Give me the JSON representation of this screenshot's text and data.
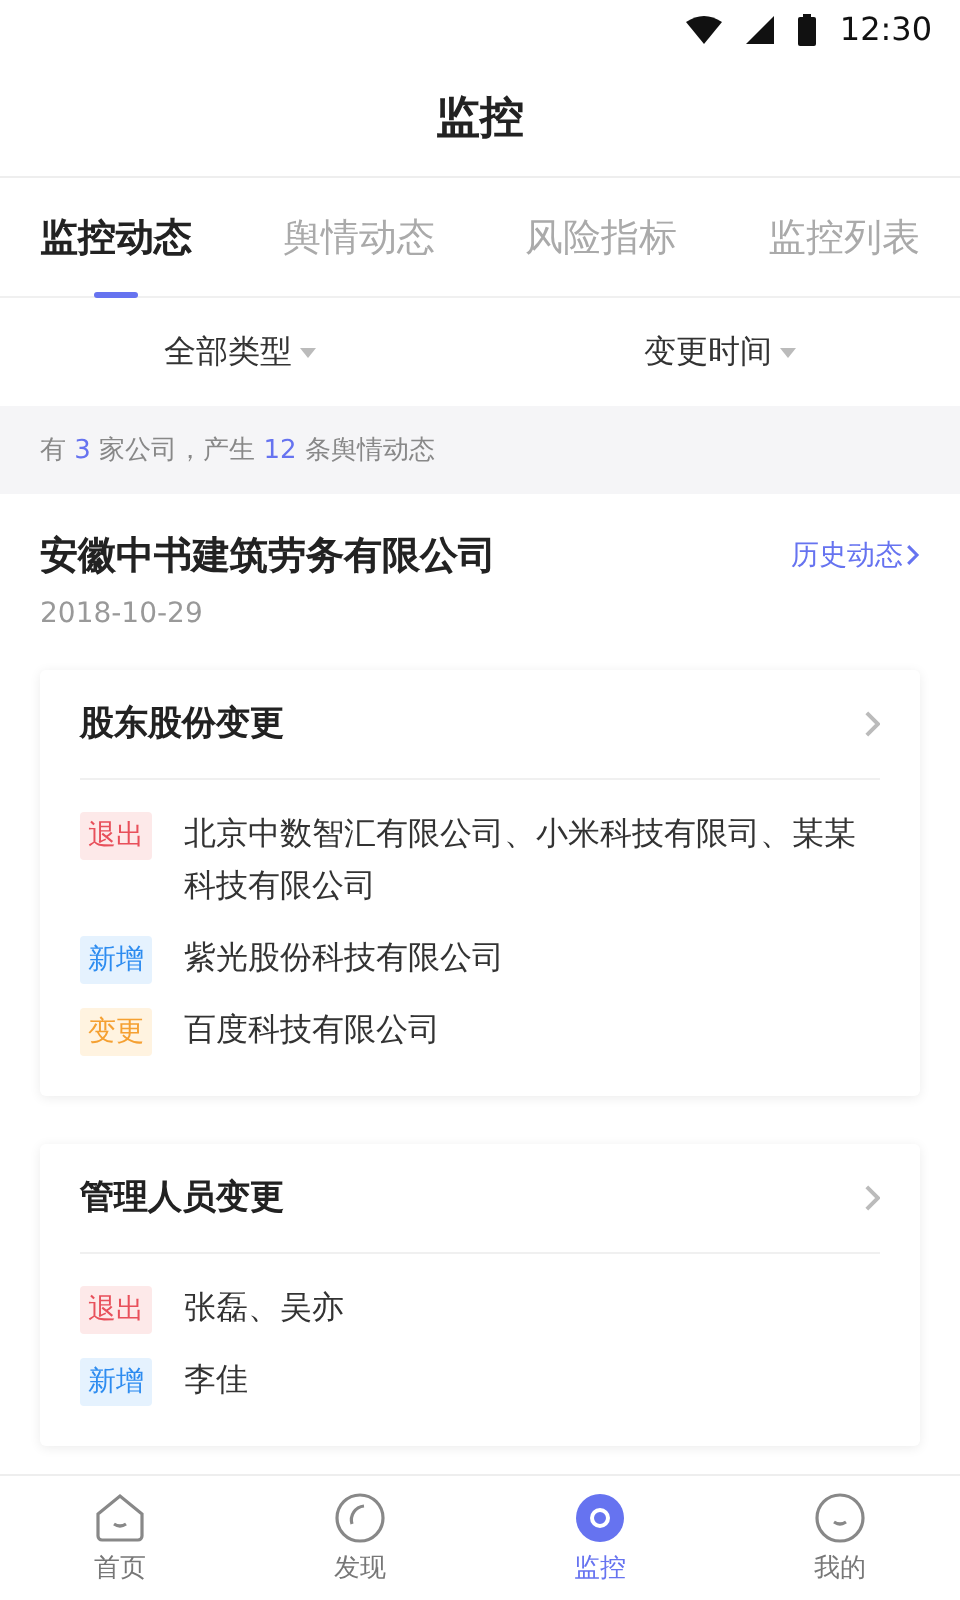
{
  "status_bar": {
    "time": "12:30"
  },
  "header": {
    "title": "监控"
  },
  "tabs": [
    {
      "label": "监控动态",
      "selected": true
    },
    {
      "label": "舆情动态",
      "selected": false
    },
    {
      "label": "风险指标",
      "selected": false
    },
    {
      "label": "监控列表",
      "selected": false
    }
  ],
  "filters": [
    {
      "label": "全部类型"
    },
    {
      "label": "变更时间"
    }
  ],
  "summary": {
    "segments": [
      {
        "text": "有 ",
        "highlight": false
      },
      {
        "text": "3",
        "highlight": true
      },
      {
        "text": " 家公司，产生 ",
        "highlight": false
      },
      {
        "text": "12",
        "highlight": true
      },
      {
        "text": " 条舆情动态",
        "highlight": false
      }
    ]
  },
  "company": {
    "name": "安徽中书建筑劳务有限公司",
    "date": "2018-10-29",
    "history_link": "历史动态"
  },
  "cards": [
    {
      "title": "股东股份变更",
      "entries": [
        {
          "kind": "exit",
          "tag": "退出",
          "text": "北京中数智汇有限公司、小米科技有限司、某某科技有限公司"
        },
        {
          "kind": "add",
          "tag": "新增",
          "text": "紫光股份科技有限公司"
        },
        {
          "kind": "change",
          "tag": "变更",
          "text": "百度科技有限公司"
        }
      ]
    },
    {
      "title": "管理人员变更",
      "entries": [
        {
          "kind": "exit",
          "tag": "退出",
          "text": "张磊、吴亦"
        },
        {
          "kind": "add",
          "tag": "新增",
          "text": "李佳"
        }
      ]
    }
  ],
  "bottom_nav": [
    {
      "kind": "home",
      "label": "首页",
      "selected": false
    },
    {
      "kind": "discover",
      "label": "发现",
      "selected": false
    },
    {
      "kind": "monitor",
      "label": "监控",
      "selected": true
    },
    {
      "kind": "me",
      "label": "我的",
      "selected": false
    }
  ]
}
